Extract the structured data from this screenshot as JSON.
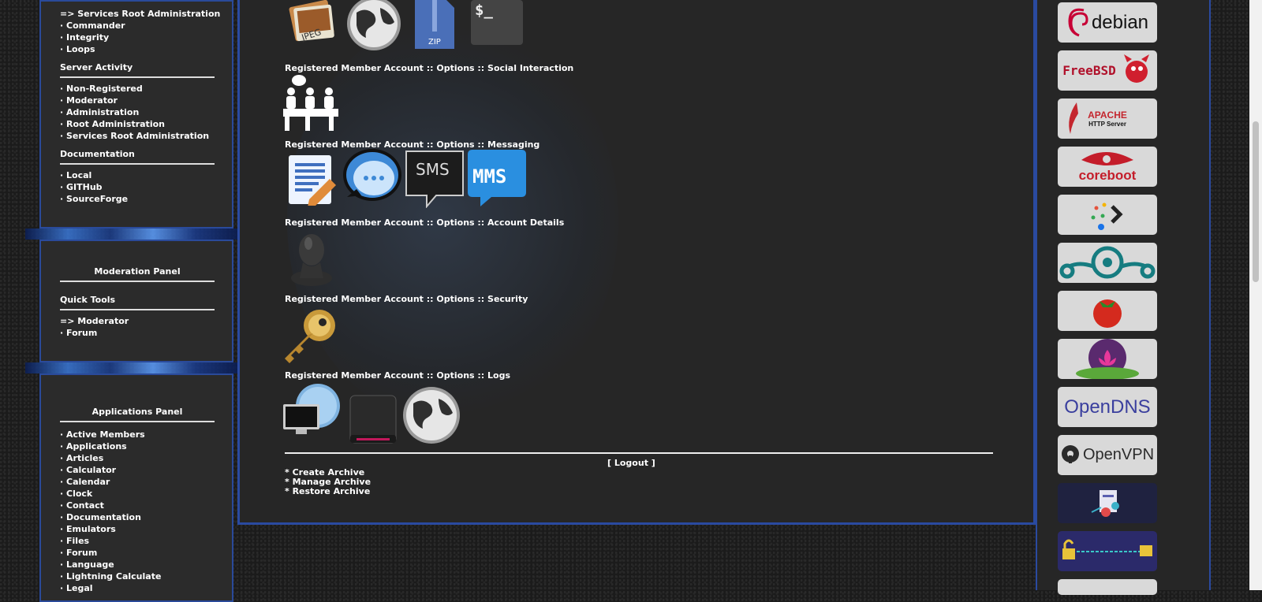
{
  "left": {
    "panel1": {
      "top_items": [
        "=> Services Root Administration",
        "· Commander",
        "· Integrity",
        "· Loops"
      ],
      "server_activity": {
        "title": "Server Activity",
        "items": [
          "· Non-Registered",
          "· Moderator",
          "· Administration",
          "· Root Administration",
          "· Services Root Administration"
        ]
      },
      "documentation": {
        "title": "Documentation",
        "items": [
          "· Local",
          "· GITHub",
          "· SourceForge"
        ]
      }
    },
    "moderation": {
      "title": "Moderation Panel",
      "quick_tools": "Quick Tools",
      "items": [
        "=> Moderator",
        "· Forum"
      ]
    },
    "applications": {
      "title": "Applications Panel",
      "items": [
        "· Active Members",
        "· Applications",
        "· Articles",
        "· Calculator",
        "· Calendar",
        "· Clock",
        "· Contact",
        "· Documentation",
        "· Emulators",
        "· Files",
        "· Forum",
        "· Language",
        "· Lightning Calculate",
        "· Legal"
      ]
    }
  },
  "main": {
    "sections": [
      {
        "label": "Registered Member Account :: Options :: Social Interaction"
      },
      {
        "label": "Registered Member Account :: Options :: Messaging"
      },
      {
        "label": "Registered Member Account :: Options :: Account Details"
      },
      {
        "label": "Registered Member Account :: Options :: Security"
      },
      {
        "label": "Registered Member Account :: Options :: Logs"
      }
    ],
    "icon_text": {
      "jpeg": "JPEG",
      "zip": "ZIP",
      "terminal": "$_",
      "sms": "SMS",
      "mms": "MMS"
    },
    "logout": {
      "open": "[ ",
      "label": "Logout",
      "close": " ]"
    },
    "archive": [
      "* Create Archive",
      "* Manage Archive",
      "* Restore Archive"
    ]
  },
  "right": {
    "logos": [
      {
        "name": "debian",
        "text": "debian"
      },
      {
        "name": "freebsd",
        "text": "FreeBSD"
      },
      {
        "name": "apache",
        "text": "APACHE",
        "sub": "HTTP Server"
      },
      {
        "name": "coreboot",
        "text": "coreboot"
      },
      {
        "name": "prompt",
        "text": ""
      },
      {
        "name": "lineage",
        "text": ""
      },
      {
        "name": "tomato",
        "text": ""
      },
      {
        "name": "lotus",
        "text": ""
      },
      {
        "name": "opendns",
        "text": "OpenDNS"
      },
      {
        "name": "openvpn",
        "text": "OpenVPN"
      },
      {
        "name": "security-illustration",
        "text": ""
      },
      {
        "name": "key-illustration",
        "text": ""
      }
    ]
  },
  "colors": {
    "accent_border": "#2a4aa0",
    "panel_bg": "#2b2b2b",
    "text": "#ffffff"
  }
}
